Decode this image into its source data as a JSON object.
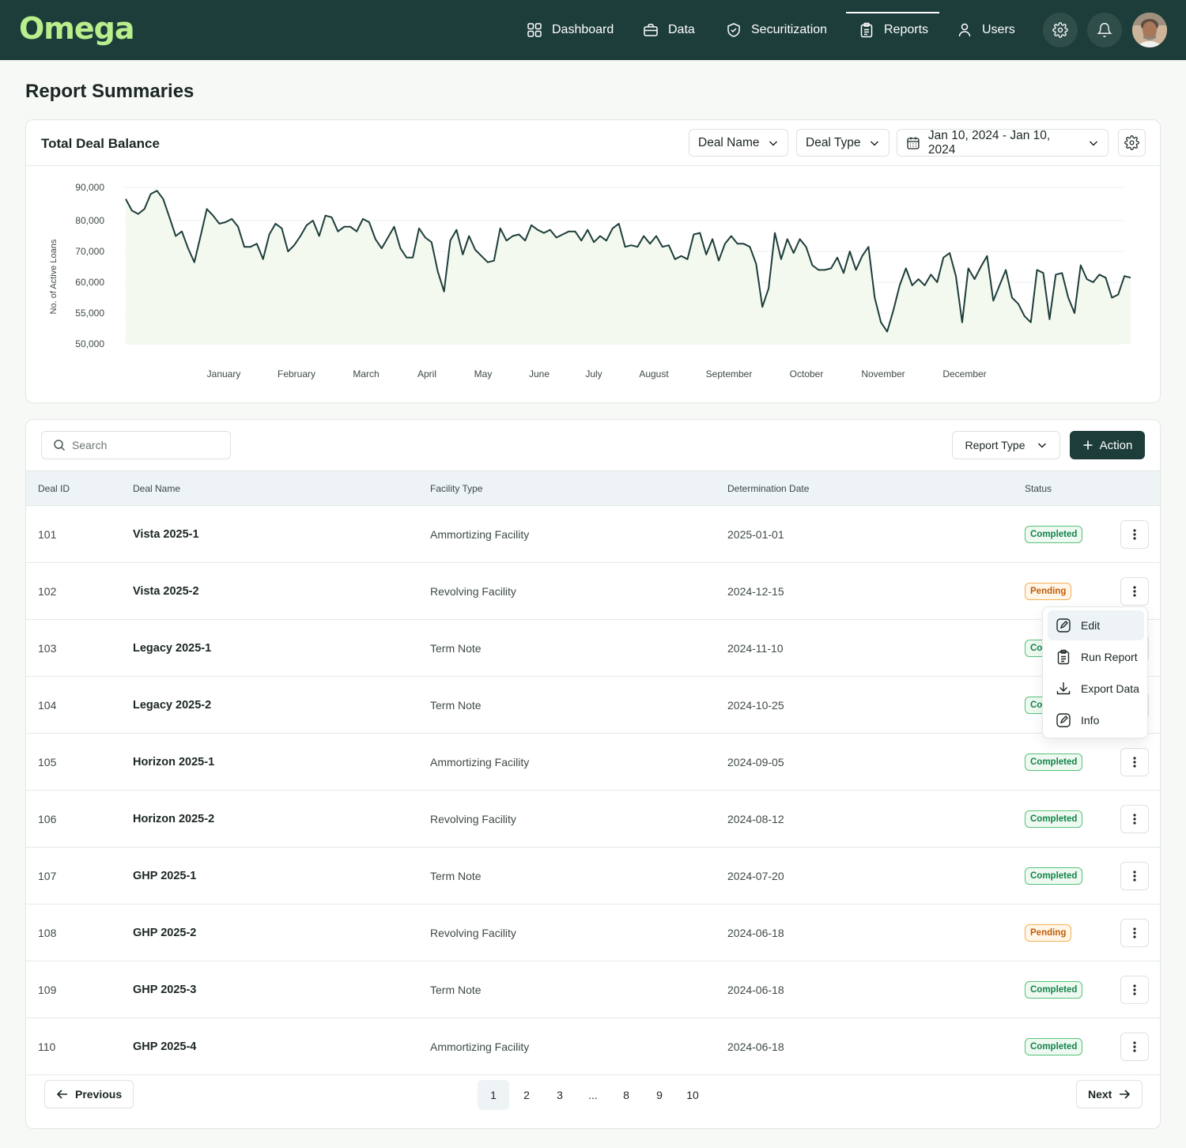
{
  "app": {
    "logo": "Omega"
  },
  "nav": {
    "items": [
      {
        "label": "Dashboard",
        "icon": "grid-icon"
      },
      {
        "label": "Data",
        "icon": "briefcase-icon"
      },
      {
        "label": "Securitization",
        "icon": "shield-icon"
      },
      {
        "label": "Reports",
        "icon": "clipboard-icon",
        "active": true
      },
      {
        "label": "Users",
        "icon": "user-icon"
      }
    ]
  },
  "page": {
    "title": "Report Summaries"
  },
  "chart_card": {
    "title": "Total Deal Balance",
    "filters": {
      "deal_name": "Deal Name",
      "deal_type": "Deal Type",
      "date_range": "Jan 10, 2024 - Jan 10, 2024"
    }
  },
  "chart_data": {
    "type": "area",
    "ylabel": "No. of Active Loans",
    "xlabel": "",
    "y_ticks": [
      "90,000",
      "80,000",
      "70,000",
      "60,000",
      "55,000",
      "50,000"
    ],
    "x_ticks": [
      "January",
      "February",
      "March",
      "April",
      "May",
      "June",
      "July",
      "August",
      "September",
      "October",
      "November",
      "December"
    ],
    "series_color": "#1d3d3a",
    "fill_color": "#f3f9ee",
    "values": [
      86500,
      83000,
      82000,
      83500,
      88000,
      89000,
      86500,
      81000,
      75000,
      76500,
      71000,
      66500,
      75000,
      83500,
      81500,
      79000,
      79500,
      80500,
      78000,
      71500,
      71500,
      72500,
      67500,
      75500,
      79000,
      77500,
      70000,
      72000,
      75000,
      78500,
      80000,
      75000,
      81500,
      81000,
      76500,
      78000,
      78000,
      76500,
      80500,
      79500,
      74000,
      71000,
      74500,
      78000,
      71000,
      68000,
      68000,
      77500,
      74500,
      73000,
      63500,
      58500,
      73500,
      77000,
      69000,
      75000,
      70500,
      68500,
      66500,
      67000,
      77500,
      73500,
      75000,
      75500,
      73500,
      78500,
      77000,
      76000,
      77000,
      74500,
      75500,
      76500,
      76500,
      73500,
      77000,
      73000,
      75000,
      73500,
      77500,
      79000,
      71500,
      72000,
      71500,
      75000,
      72500,
      75000,
      71500,
      72000,
      67500,
      68500,
      67500,
      75500,
      76000,
      69000,
      74000,
      67000,
      72500,
      75000,
      72500,
      72500,
      71500,
      66000,
      56000,
      59000,
      76000,
      67500,
      74000,
      69500,
      74000,
      71500,
      65500,
      64000,
      64000,
      64500,
      68000,
      63000,
      70000,
      64000,
      68500,
      71500,
      57500,
      53500,
      52000,
      55500,
      59500,
      64500,
      59500,
      61000,
      59500,
      62500,
      60000,
      68000,
      69500,
      62000,
      53500,
      64500,
      61000,
      65000,
      68500,
      57000,
      59500,
      64000,
      57500,
      56500,
      54500,
      53500,
      64000,
      63000,
      54000,
      62500,
      63000,
      57500,
      55000,
      65500,
      61000,
      60000,
      62500,
      61500,
      57500,
      58000,
      62000,
      61500
    ],
    "grid": true,
    "legend": "none"
  },
  "table": {
    "search_placeholder": "Search",
    "report_type_label": "Report Type",
    "action_label": "Action",
    "columns": [
      "Deal ID",
      "Deal Name",
      "Facility Type",
      "Determination Date",
      "Status"
    ],
    "rows": [
      {
        "id": "101",
        "name": "Vista 2025-1",
        "facility": "Ammortizing Facility",
        "date": "2025-01-01",
        "status": "Completed"
      },
      {
        "id": "102",
        "name": "Vista 2025-2",
        "facility": "Revolving Facility",
        "date": "2024-12-15",
        "status": "Pending"
      },
      {
        "id": "103",
        "name": "Legacy 2025-1",
        "facility": "Term Note",
        "date": "2024-11-10",
        "status": "Completed"
      },
      {
        "id": "104",
        "name": "Legacy 2025-2",
        "facility": "Term Note",
        "date": "2024-10-25",
        "status": "Completed"
      },
      {
        "id": "105",
        "name": "Horizon 2025-1",
        "facility": "Ammortizing Facility",
        "date": "2024-09-05",
        "status": "Completed"
      },
      {
        "id": "106",
        "name": "Horizon 2025-2",
        "facility": "Revolving Facility",
        "date": "2024-08-12",
        "status": "Completed"
      },
      {
        "id": "107",
        "name": "GHP 2025-1",
        "facility": "Term Note",
        "date": "2024-07-20",
        "status": "Completed"
      },
      {
        "id": "108",
        "name": "GHP 2025-2",
        "facility": "Revolving Facility",
        "date": "2024-06-18",
        "status": "Pending"
      },
      {
        "id": "109",
        "name": "GHP 2025-3",
        "facility": "Term Note",
        "date": "2024-06-18",
        "status": "Completed"
      },
      {
        "id": "110",
        "name": "GHP 2025-4",
        "facility": "Ammortizing Facility",
        "date": "2024-06-18",
        "status": "Completed"
      }
    ],
    "row_menu": {
      "items": [
        "Edit",
        "Run Report",
        "Export Data",
        "Info"
      ]
    }
  },
  "pagination": {
    "previous": "Previous",
    "next": "Next",
    "pages": [
      "1",
      "2",
      "3",
      "...",
      "8",
      "9",
      "10"
    ],
    "current": "1"
  }
}
